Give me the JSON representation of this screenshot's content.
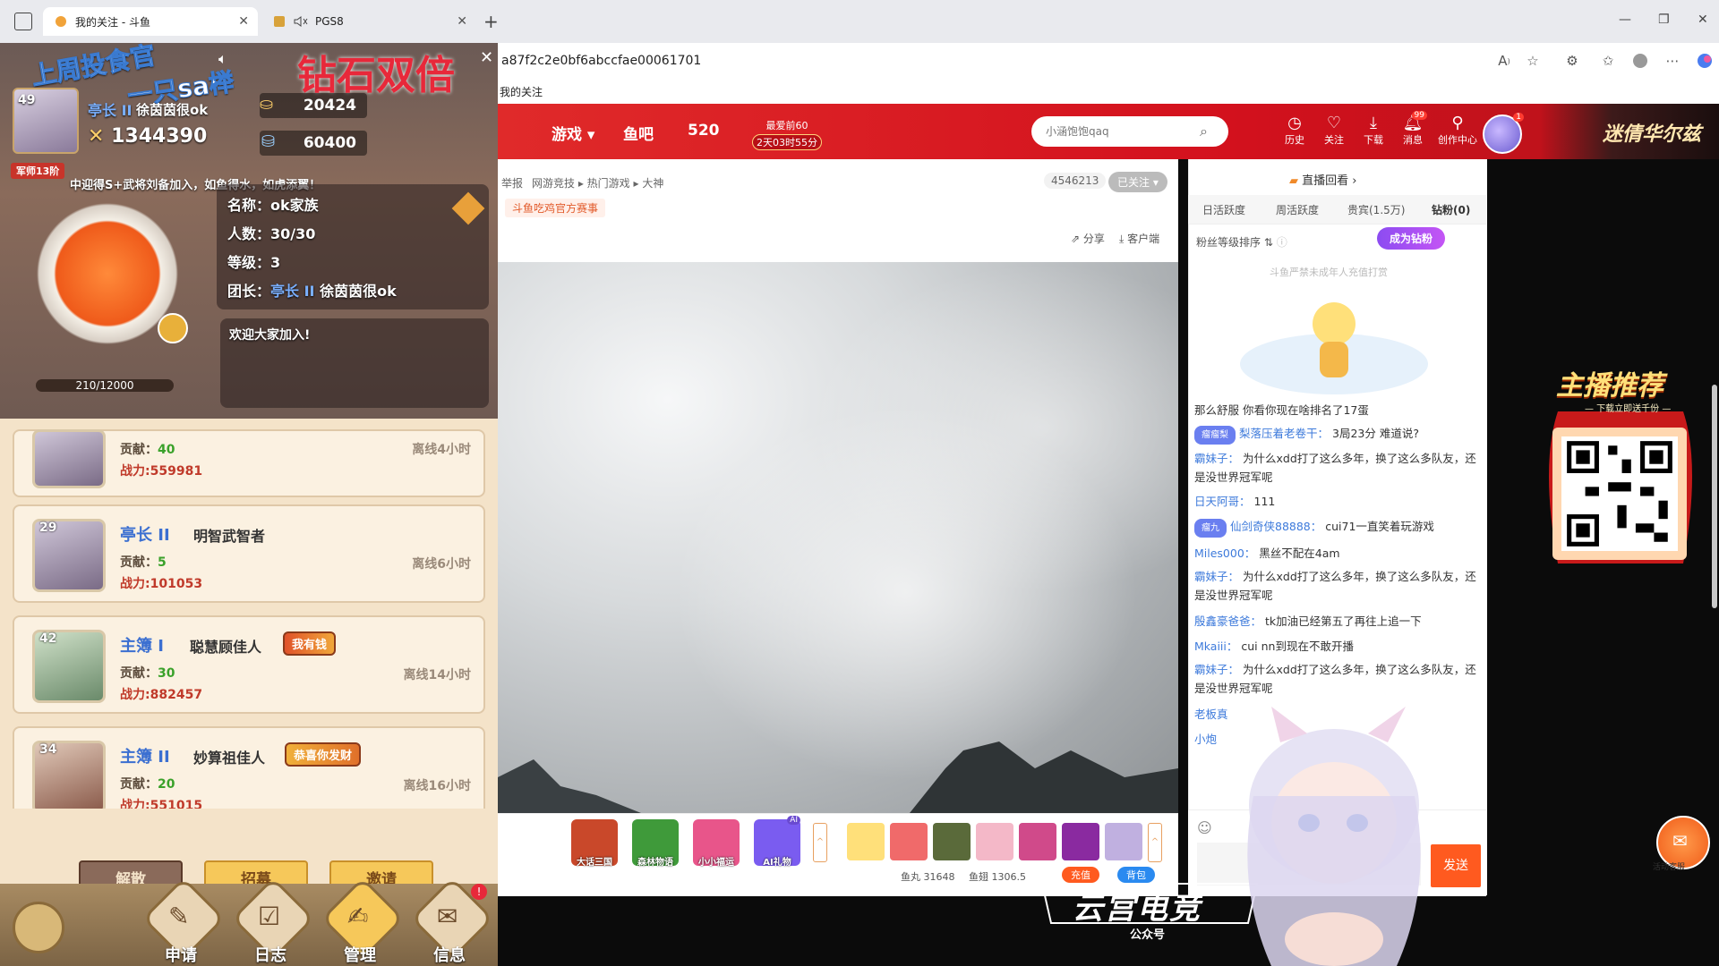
{
  "browser": {
    "tabs": [
      {
        "title": "我的关注 - 斗鱼",
        "active": true
      },
      {
        "title": "PGS8",
        "active": false
      }
    ],
    "new_tab": "+",
    "url": "a87f2c2e0bf6abccfae00061701",
    "favorites_item": "我的关注",
    "window_controls": {
      "minimize": "—",
      "restore": "❐",
      "close": "✕"
    }
  },
  "site_header": {
    "nav": [
      {
        "label": "游戏 ▾"
      },
      {
        "label": "鱼吧"
      },
      {
        "label": "520"
      }
    ],
    "promo": {
      "line1": "最爱前60",
      "countdown": "2天03时55分"
    },
    "search_placeholder": "小涵饱饱qaq",
    "icons": [
      {
        "icon": "history-icon",
        "label": "历史"
      },
      {
        "icon": "follow-icon",
        "label": "关注"
      },
      {
        "icon": "download-icon",
        "label": "下载"
      },
      {
        "icon": "message-icon",
        "label": "消息",
        "badge": "99"
      },
      {
        "icon": "creator-icon",
        "label": "创作中心"
      }
    ],
    "avatar_badge": "1",
    "banner_title": "迷倩华尔兹"
  },
  "room": {
    "report": "举报",
    "breadcrumbs": "网游竞技 ▸ 热门游戏 ▸ 大神",
    "tag": "斗鱼吃鸡官方赛事",
    "viewers": "4546213",
    "follow_button": "已关注 ▾",
    "share": "分享",
    "client": "客户端"
  },
  "gift_bar": {
    "gifts": [
      {
        "label": "大话三国",
        "color": "#c9482a"
      },
      {
        "label": "森林物语",
        "color": "#3f9a3a"
      },
      {
        "label": "小小福运",
        "color": "#e8558a"
      },
      {
        "label": "AI礼物",
        "color": "#7a5cf0",
        "badge": "AI"
      }
    ],
    "fish_ball": "鱼丸 31648",
    "fish_fin": "鱼翅 1306.5",
    "recharge": "充值",
    "backpack": "背包"
  },
  "sidebar": {
    "replay": "直播回看 ›",
    "tabs": [
      "日活跃度",
      "周活跃度",
      "贵宾(1.5万)",
      "钻粉(0)"
    ],
    "fan_rank": "粉丝等级排序 ⇅",
    "become_diamond": "成为钻粉",
    "minor_note": "斗鱼严禁未成年人充值打赏",
    "send": "发送"
  },
  "chat": [
    {
      "user": "",
      "text": "那么舒服 你看你现在啥排名了17蛋"
    },
    {
      "badge": "瘤瘤梨",
      "user": "梨落压着老卷干：",
      "text": "3局23分 难道说?"
    },
    {
      "user": "霸妹子：",
      "text": "为什么xdd打了这么多年，换了这么多队友，还是没世界冠军呢"
    },
    {
      "user": "日天阿哥：",
      "text": "111"
    },
    {
      "badge": "瘤九",
      "user": "仙剑奇侠88888：",
      "text": "cui71一直笑着玩游戏"
    },
    {
      "user": "Miles000：",
      "text": "黑丝不配在4am"
    },
    {
      "user": "霸妹子：",
      "text": "为什么xdd打了这么多年，换了这么多队友，还是没世界冠军呢"
    },
    {
      "user": "殷鑫豪爸爸：",
      "text": "tk加油已经第五了再往上追一下"
    },
    {
      "user": "Mkaiii：",
      "text": "cui nn到现在不敢开播"
    },
    {
      "user": "霸妹子：",
      "text": "为什么xdd打了这么多年，换了这么多队友，还是没世界冠军呢"
    },
    {
      "user": "老板真",
      "text": ""
    },
    {
      "user": "小炮",
      "text": ""
    }
  ],
  "right_promo": {
    "title": "主播推荐",
    "sub": "— 下载立即送千份 —"
  },
  "service_label": "活动客服",
  "overlay_logo": {
    "title": "云宫电竞",
    "sub": "公众号"
  },
  "game": {
    "title_overlay": "钻石双倍",
    "cheer_overlay": "上周投食官",
    "cheer_name": "一只sa榉",
    "leader": {
      "level": "49",
      "role": "亭长 II",
      "name": "徐茵茵很ok",
      "power": "1344390",
      "rank": "军师13阶"
    },
    "resources": [
      "20424",
      "60400"
    ],
    "notice": "中迎得S+武将刘备加入，如鱼得水，如虎添翼！",
    "family": {
      "name_label": "名称：",
      "name": "ok家族",
      "count_label": "人数：",
      "count": "30/30",
      "grade_label": "等级：",
      "grade": "3",
      "head_label": "团长：",
      "head_role": "亭长 II",
      "head_name": "徐茵茵很ok"
    },
    "welcome": "欢迎大家加入!",
    "xp": "210/12000",
    "members": [
      {
        "level": "",
        "role": "",
        "name": "",
        "contrib": "40",
        "power": "559981",
        "offline": "离线4小时",
        "tag": ""
      },
      {
        "level": "29",
        "role": "亭长 II",
        "name": "明智武智者",
        "contrib": "5",
        "power": "101053",
        "offline": "离线6小时",
        "tag": ""
      },
      {
        "level": "42",
        "role": "主簿 I",
        "name": "聪慧顾佳人",
        "contrib": "30",
        "power": "882457",
        "offline": "离线14小时",
        "tag": "我有钱"
      },
      {
        "level": "34",
        "role": "主簿 II",
        "name": "妙算祖佳人",
        "contrib": "20",
        "power": "551015",
        "offline": "离线16小时",
        "tag": "恭喜你发财"
      }
    ],
    "contrib_label": "贡献：",
    "power_label": "战力:",
    "buttons": [
      "解散",
      "招募",
      "邀请"
    ],
    "footer": [
      {
        "label": "申请",
        "icon": "apply-icon",
        "alert": false
      },
      {
        "label": "日志",
        "icon": "log-icon",
        "alert": false
      },
      {
        "label": "管理",
        "icon": "manage-icon",
        "alert": false
      },
      {
        "label": "信息",
        "icon": "info-icon",
        "alert": true
      }
    ]
  }
}
